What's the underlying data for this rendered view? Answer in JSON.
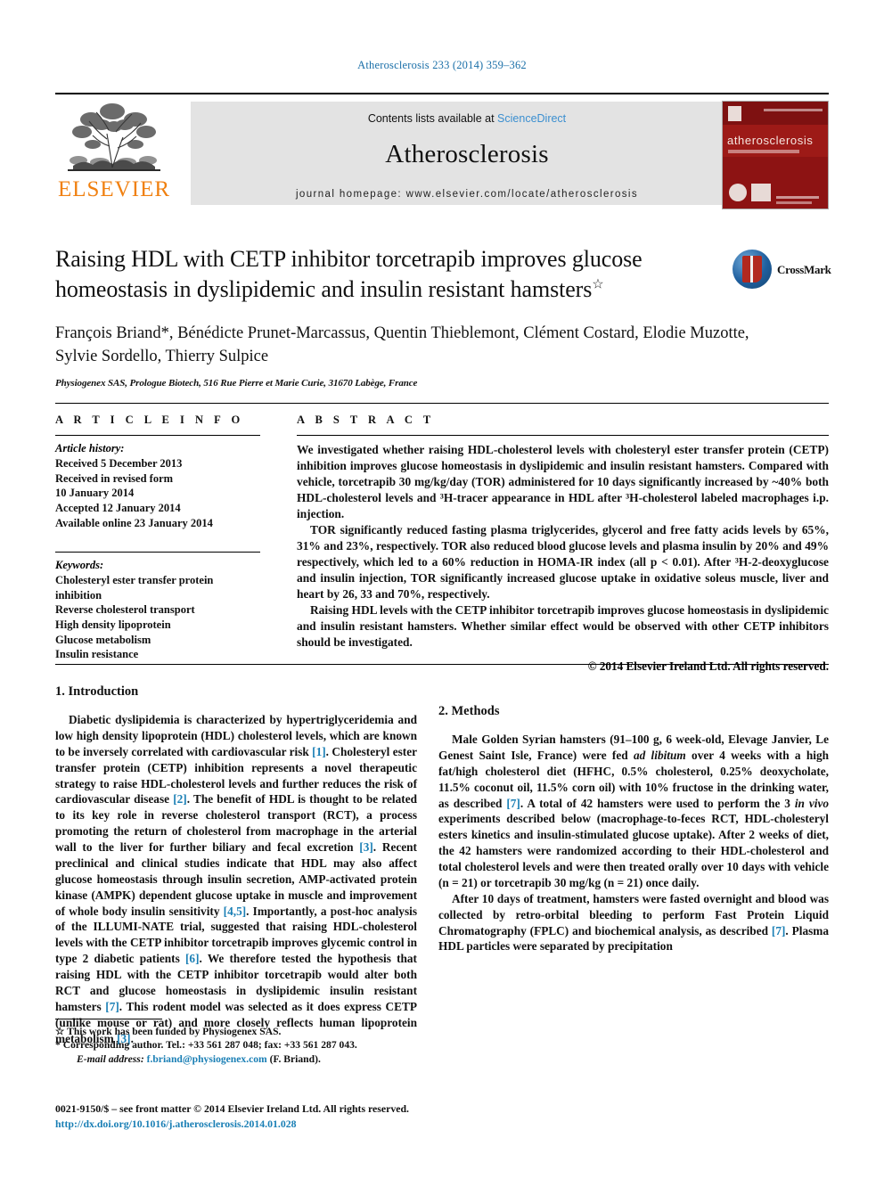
{
  "running_head": "Atherosclerosis 233 (2014) 359–362",
  "masthead": {
    "publisher": "ELSEVIER",
    "contents_prefix": "Contents lists available at",
    "contents_link": "ScienceDirect",
    "journal_name": "Atherosclerosis",
    "homepage": "journal homepage: www.elsevier.com/locate/atherosclerosis",
    "cover_title": "atherosclerosis"
  },
  "article": {
    "title": "Raising HDL with CETP inhibitor torcetrapib improves glucose homeostasis in dyslipidemic and insulin resistant hamsters",
    "title_footnote_mark": "☆",
    "crossmark_label": "CrossMark",
    "authors": "François Briand*, Bénédicte Prunet-Marcassus, Quentin Thieblemont, Clément Costard, Elodie Muzotte, Sylvie Sordello, Thierry Sulpice",
    "affiliation": "Physiogenex SAS, Prologue Biotech, 516 Rue Pierre et Marie Curie, 31670 Labège, France"
  },
  "article_info": {
    "heading": "A R T I C L E   I N F O",
    "history_label": "Article history:",
    "history": [
      "Received 5 December 2013",
      "Received in revised form",
      "10 January 2014",
      "Accepted 12 January 2014",
      "Available online 23 January 2014"
    ],
    "keywords_label": "Keywords:",
    "keywords": [
      "Cholesteryl ester transfer protein inhibition",
      "Reverse cholesterol transport",
      "High density lipoprotein",
      "Glucose metabolism",
      "Insulin resistance"
    ]
  },
  "abstract": {
    "heading": "A B S T R A C T",
    "paragraphs": [
      "We investigated whether raising HDL-cholesterol levels with cholesteryl ester transfer protein (CETP) inhibition improves glucose homeostasis in dyslipidemic and insulin resistant hamsters. Compared with vehicle, torcetrapib 30 mg/kg/day (TOR) administered for 10 days significantly increased by ~40% both HDL-cholesterol levels and ³H-tracer appearance in HDL after ³H-cholesterol labeled macrophages i.p. injection.",
      "TOR significantly reduced fasting plasma triglycerides, glycerol and free fatty acids levels by 65%, 31% and 23%, respectively. TOR also reduced blood glucose levels and plasma insulin by 20% and 49% respectively, which led to a 60% reduction in HOMA-IR index (all p < 0.01). After ³H-2-deoxyglucose and insulin injection, TOR significantly increased glucose uptake in oxidative soleus muscle, liver and heart by 26, 33 and 70%, respectively.",
      "Raising HDL levels with the CETP inhibitor torcetrapib improves glucose homeostasis in dyslipidemic and insulin resistant hamsters. Whether similar effect would be observed with other CETP inhibitors should be investigated."
    ],
    "copyright": "© 2014 Elsevier Ireland Ltd. All rights reserved."
  },
  "sections": {
    "introduction_heading": "1.  Introduction",
    "methods_heading": "2.  Methods",
    "intro_p1_a": "Diabetic dyslipidemia is characterized by hypertriglyceridemia and low high density lipoprotein (HDL) cholesterol levels, which are known to be inversely correlated with cardiovascular risk ",
    "intro_ref1": "[1]",
    "intro_p1_b": ". Cholesteryl ester transfer protein (CETP) inhibition represents a novel therapeutic strategy to raise HDL-cholesterol levels and further reduces the risk of cardiovascular disease ",
    "intro_ref2": "[2]",
    "intro_p1_c": ". The benefit of HDL is thought to be related to its key role in reverse cholesterol transport (RCT), a process promoting the return of cholesterol from macrophage in the arterial wall to the liver for further biliary and fecal excretion ",
    "intro_ref3": "[3]",
    "intro_p1_d": ". Recent preclinical and clinical studies indicate that HDL may also affect glucose homeostasis through insulin secretion, AMP-activated protein kinase (AMPK) dependent glucose uptake in muscle and improvement of whole body insulin sensitivity ",
    "intro_ref45": "[4,5]",
    "intro_p1_e": ". Importantly, a post-hoc analysis of the ILLUMI-NATE trial, suggested that raising HDL-cholesterol levels with the CETP inhibitor torcetrapib improves glycemic control in type 2 diabetic patients ",
    "intro_ref6": "[6]",
    "intro_p1_f": ". We therefore tested the hypothesis that raising HDL with the CETP inhibitor torcetrapib would alter both RCT and glucose homeostasis in dyslipidemic insulin resistant hamsters ",
    "intro_ref7": "[7]",
    "intro_p1_g": ". This rodent model was selected as it does express CETP (unlike mouse or rat) and more closely reflects human lipoprotein metabolism ",
    "intro_ref3b": "[3]",
    "intro_p1_h": ".",
    "methods_p1_a": "Male Golden Syrian hamsters (91–100 g, 6 week-old, Elevage Janvier, Le Genest Saint Isle, France) were fed ",
    "methods_italic1": "ad libitum",
    "methods_p1_b": " over 4 weeks with a high fat/high cholesterol diet (HFHC, 0.5% cholesterol, 0.25% deoxycholate, 11.5% coconut oil, 11.5% corn oil) with 10% fructose in the drinking water, as described ",
    "methods_ref7": "[7]",
    "methods_p1_c": ". A total of 42 hamsters were used to perform the 3 ",
    "methods_italic2": "in vivo",
    "methods_p1_d": " experiments described below (macrophage-to-feces RCT, HDL-cholesteryl esters kinetics and insulin-stimulated glucose uptake). After 2 weeks of diet, the 42 hamsters were randomized according to their HDL-cholesterol and total cholesterol levels and were then treated orally over 10 days with vehicle (n = 21) or torcetrapib 30 mg/kg (n = 21) once daily.",
    "methods_p2_a": "After 10 days of treatment, hamsters were fasted overnight and blood was collected by retro-orbital bleeding to perform Fast Protein Liquid Chromatography (FPLC) and biochemical analysis, as described ",
    "methods_ref7b": "[7]",
    "methods_p2_b": ". Plasma HDL particles were separated by precipitation"
  },
  "footnotes": {
    "funding_mark": "☆",
    "funding": "This work has been funded by Physiogenex SAS.",
    "corresponding_mark": "*",
    "corresponding": "Corresponding author. Tel.: +33 561 287 048; fax: +33 561 287 043.",
    "email_label": "E-mail address:",
    "email": "f.briand@physiogenex.com",
    "email_suffix": "(F. Briand)."
  },
  "imprint": {
    "line1": "0021-9150/$ – see front matter © 2014 Elsevier Ireland Ltd. All rights reserved.",
    "doi": "http://dx.doi.org/10.1016/j.atherosclerosis.2014.01.028"
  }
}
